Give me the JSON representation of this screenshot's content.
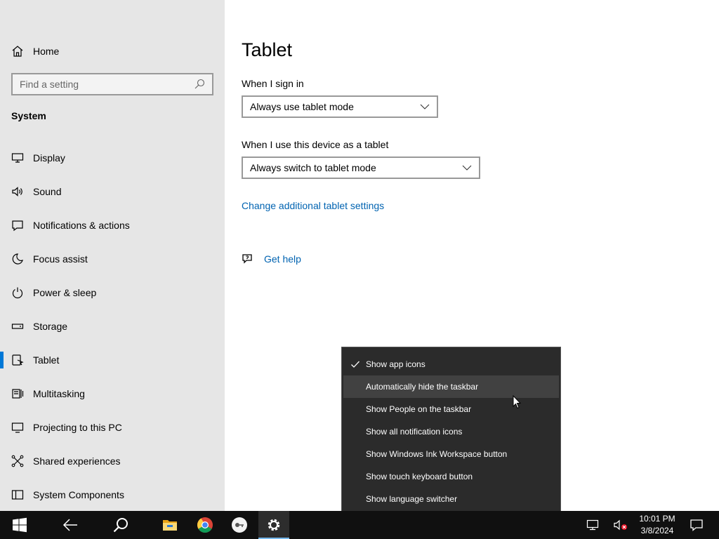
{
  "sidebar": {
    "home_label": "Home",
    "search_placeholder": "Find a setting",
    "section_label": "System",
    "items": [
      {
        "label": "Display",
        "icon": "display-icon"
      },
      {
        "label": "Sound",
        "icon": "sound-icon"
      },
      {
        "label": "Notifications & actions",
        "icon": "notifications-icon"
      },
      {
        "label": "Focus assist",
        "icon": "focus-assist-icon"
      },
      {
        "label": "Power & sleep",
        "icon": "power-icon"
      },
      {
        "label": "Storage",
        "icon": "storage-icon"
      },
      {
        "label": "Tablet",
        "icon": "tablet-icon",
        "active": true
      },
      {
        "label": "Multitasking",
        "icon": "multitasking-icon"
      },
      {
        "label": "Projecting to this PC",
        "icon": "projecting-icon"
      },
      {
        "label": "Shared experiences",
        "icon": "shared-experiences-icon"
      },
      {
        "label": "System Components",
        "icon": "system-components-icon"
      }
    ]
  },
  "main": {
    "title": "Tablet",
    "sign_in_label": "When I sign in",
    "sign_in_value": "Always use tablet mode",
    "tablet_label": "When I use this device as a tablet",
    "tablet_value": "Always switch to tablet mode",
    "link_label": "Change additional tablet settings",
    "help_label": "Get help"
  },
  "context_menu": {
    "items": [
      {
        "label": "Show app icons",
        "checked": true
      },
      {
        "label": "Automatically hide the taskbar",
        "hover": true
      },
      {
        "label": "Show People on the taskbar"
      },
      {
        "label": "Show all notification icons"
      },
      {
        "label": "Show Windows Ink Workspace button"
      },
      {
        "label": "Show touch keyboard button"
      },
      {
        "label": "Show language switcher"
      }
    ]
  },
  "taskbar": {
    "time": "10:01 PM",
    "date": "3/8/2024",
    "apps": [
      "start-icon",
      "back-icon",
      "search-icon",
      "file-explorer-icon",
      "chrome-icon",
      "app-icon",
      "settings-icon"
    ],
    "tray": [
      "network-icon",
      "volume-muted-icon",
      "action-center-icon"
    ]
  },
  "colors": {
    "accent": "#0078d7",
    "link": "#0063b1",
    "sidebar_bg": "#e6e6e6",
    "menu_bg": "#2b2b2b",
    "taskbar_bg": "#101010"
  }
}
